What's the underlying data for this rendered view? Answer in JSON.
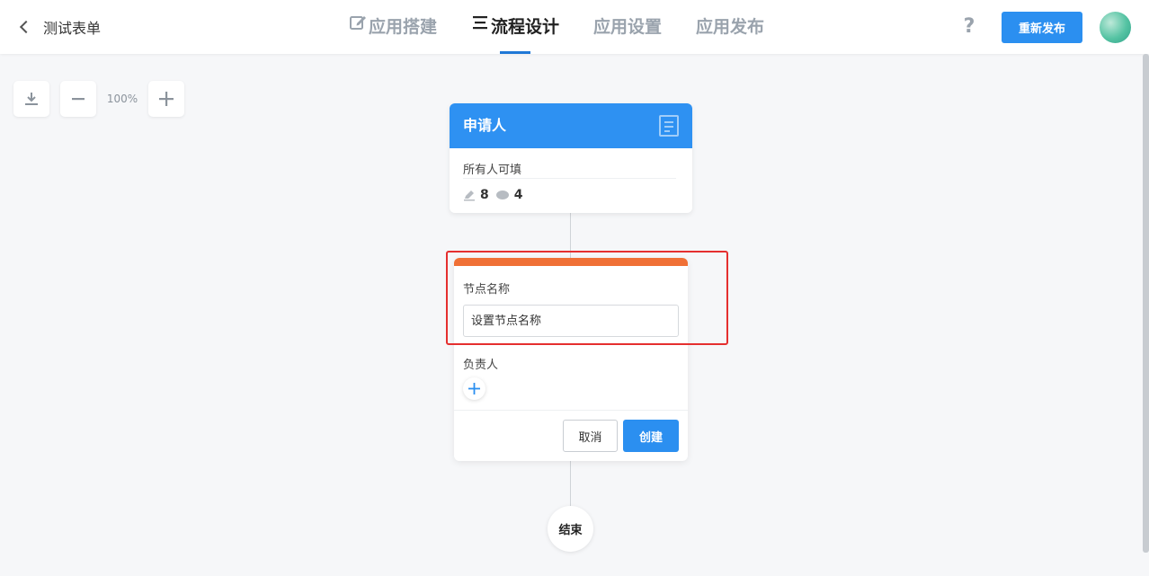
{
  "header": {
    "back_label": "测试表单",
    "tabs": [
      {
        "label": "应用搭建",
        "icon": "edit-icon",
        "active": false
      },
      {
        "label": "流程设计",
        "icon": "flow-icon",
        "active": true
      },
      {
        "label": "应用设置",
        "active": false
      },
      {
        "label": "应用发布",
        "active": false
      }
    ],
    "help_label": "?",
    "republish_label": "重新发布"
  },
  "toolbar": {
    "zoom_level": "100%"
  },
  "applicant_node": {
    "title": "申请人",
    "permission": "所有人可填",
    "edit_count": "8",
    "view_count": "4"
  },
  "node_form": {
    "name_label": "节点名称",
    "name_placeholder": "设置节点名称",
    "owner_label": "负责人",
    "cancel_label": "取消",
    "create_label": "创建"
  },
  "end_node": {
    "label": "结束"
  },
  "colors": {
    "primary": "#2b8ff0",
    "node_header": "#2e91f2",
    "node_accent": "#f07036",
    "highlight": "#e52f2f"
  }
}
